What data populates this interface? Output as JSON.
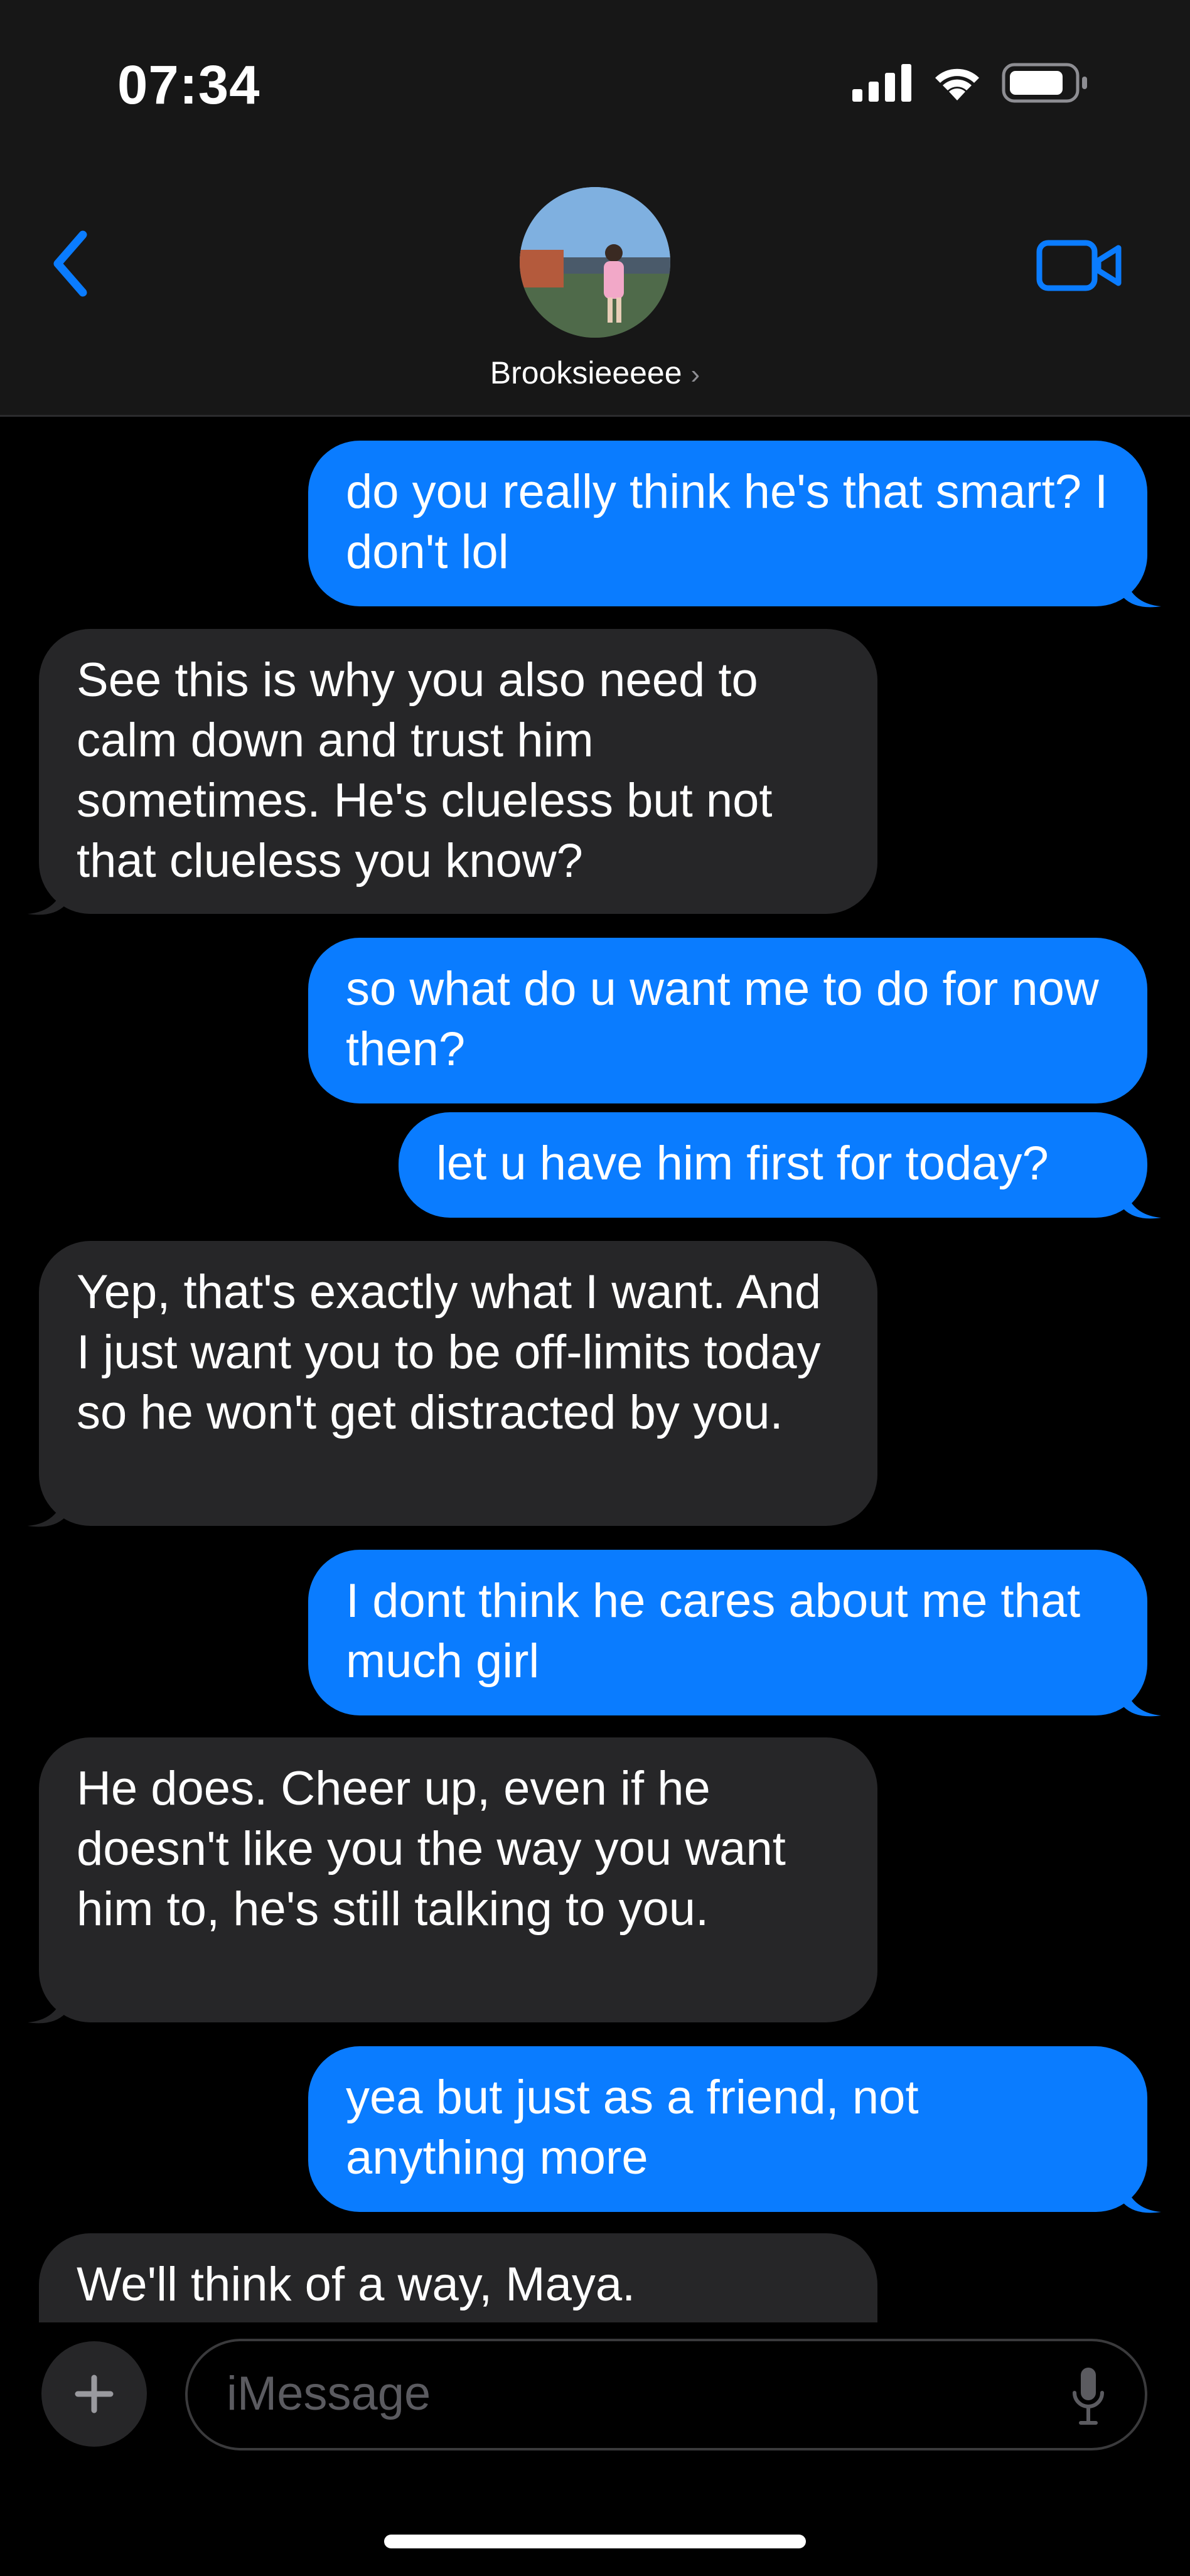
{
  "status_bar": {
    "time": "07:34",
    "icons": [
      "signal-icon",
      "wifi-icon",
      "battery-icon"
    ]
  },
  "header": {
    "contact_name": "Brooksieeeee",
    "back_icon": "chevron-left-icon",
    "video_icon": "video-camera-icon",
    "accent": "#0a7cff"
  },
  "messages": [
    {
      "from": "me",
      "text": "do you really think he's that smart? I don't lol"
    },
    {
      "from": "them",
      "text": "See this is why you also need to calm down and trust him sometimes. He's clueless but not that clueless you know?"
    },
    {
      "from": "me",
      "text": "so what do u want me to do for now then?"
    },
    {
      "from": "me",
      "text": "let u have him first for today?"
    },
    {
      "from": "them",
      "text": "Yep, that's exactly what I want. And I just want you to be off-limits today so he won't get distracted by you."
    },
    {
      "from": "me",
      "text": "I dont think he cares about me that much girl"
    },
    {
      "from": "them",
      "text": "He does. Cheer up, even if he doesn't like you the way you want him to, he's still talking to you."
    },
    {
      "from": "me",
      "text": "yea but just as a friend, not anything more"
    },
    {
      "from": "them",
      "text": "We'll think of a way, Maya."
    }
  ],
  "composer": {
    "placeholder": "iMessage",
    "plus_icon": "plus-icon",
    "mic_icon": "microphone-icon"
  },
  "colors": {
    "sent_bubble": "#0a7cff",
    "received_bubble": "#262628",
    "background": "#000000"
  }
}
